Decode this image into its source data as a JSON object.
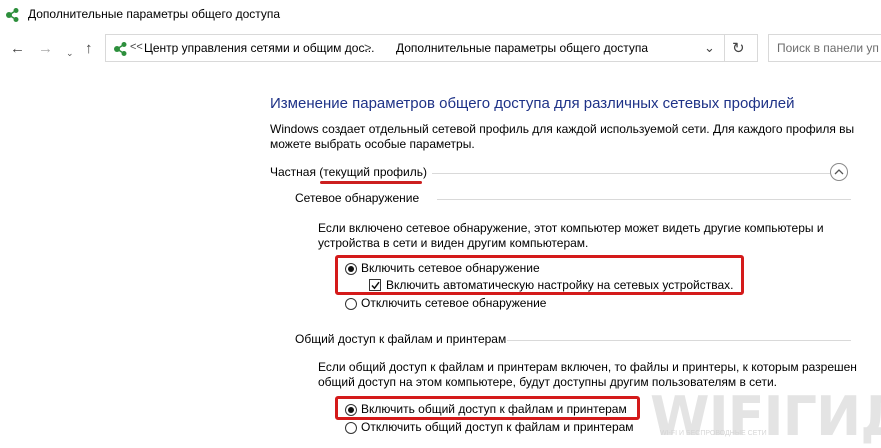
{
  "window": {
    "title": "Дополнительные параметры общего доступа"
  },
  "nav": {
    "back_icon": "arrow-left-icon",
    "forward_icon": "arrow-right-icon",
    "up_icon": "arrow-up-icon",
    "address": {
      "chevron": "<<",
      "crumb1": "Центр управления сетями и общим дос...",
      "separator": ">",
      "crumb2": "Дополнительные параметры общего доступа"
    },
    "search_placeholder": "Поиск в панели уп"
  },
  "content": {
    "title": "Изменение параметров общего доступа для различных сетевых профилей",
    "description": "Windows создает отдельный сетевой профиль для каждой используемой сети. Для каждого профиля вы можете выбрать особые параметры.",
    "profile": {
      "header": "Частная (текущий профиль)",
      "discovery": {
        "header": "Сетевое обнаружение",
        "description": "Если включено сетевое обнаружение, этот компьютер может видеть другие компьютеры и устройства в сети и виден другим компьютерам.",
        "enable_label": "Включить сетевое обнаружение",
        "auto_setup_label": "Включить автоматическую настройку на сетевых устройствах.",
        "disable_label": "Отключить сетевое обнаружение",
        "enabled": true,
        "auto_setup_checked": true
      },
      "sharing": {
        "header": "Общий доступ к файлам и принтерам",
        "description": "Если общий доступ к файлам и принтерам включен, то файлы и принтеры, к которым разрешен общий доступ на этом компьютере, будут доступны другим пользователям в сети.",
        "enable_label": "Включить общий доступ к файлам и принтерам",
        "disable_label": "Отключить общий доступ к файлам и принтерам",
        "enabled": true
      }
    }
  },
  "watermark": {
    "logo": "WIFIГИД",
    "tagline": "WI-FI И БЕСПРОВОДНЫЕ СЕТИ"
  },
  "colors": {
    "title_blue": "#1e3287",
    "highlight_red": "#d41a1a"
  }
}
